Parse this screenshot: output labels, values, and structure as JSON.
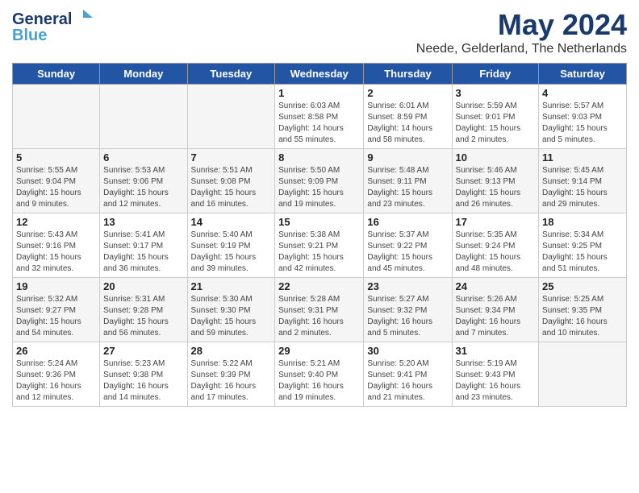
{
  "header": {
    "logo_general": "General",
    "logo_blue": "Blue",
    "month_title": "May 2024",
    "location": "Neede, Gelderland, The Netherlands"
  },
  "days_of_week": [
    "Sunday",
    "Monday",
    "Tuesday",
    "Wednesday",
    "Thursday",
    "Friday",
    "Saturday"
  ],
  "weeks": [
    [
      {
        "day": "",
        "info": ""
      },
      {
        "day": "",
        "info": ""
      },
      {
        "day": "",
        "info": ""
      },
      {
        "day": "1",
        "info": "Sunrise: 6:03 AM\nSunset: 8:58 PM\nDaylight: 14 hours\nand 55 minutes."
      },
      {
        "day": "2",
        "info": "Sunrise: 6:01 AM\nSunset: 8:59 PM\nDaylight: 14 hours\nand 58 minutes."
      },
      {
        "day": "3",
        "info": "Sunrise: 5:59 AM\nSunset: 9:01 PM\nDaylight: 15 hours\nand 2 minutes."
      },
      {
        "day": "4",
        "info": "Sunrise: 5:57 AM\nSunset: 9:03 PM\nDaylight: 15 hours\nand 5 minutes."
      }
    ],
    [
      {
        "day": "5",
        "info": "Sunrise: 5:55 AM\nSunset: 9:04 PM\nDaylight: 15 hours\nand 9 minutes."
      },
      {
        "day": "6",
        "info": "Sunrise: 5:53 AM\nSunset: 9:06 PM\nDaylight: 15 hours\nand 12 minutes."
      },
      {
        "day": "7",
        "info": "Sunrise: 5:51 AM\nSunset: 9:08 PM\nDaylight: 15 hours\nand 16 minutes."
      },
      {
        "day": "8",
        "info": "Sunrise: 5:50 AM\nSunset: 9:09 PM\nDaylight: 15 hours\nand 19 minutes."
      },
      {
        "day": "9",
        "info": "Sunrise: 5:48 AM\nSunset: 9:11 PM\nDaylight: 15 hours\nand 23 minutes."
      },
      {
        "day": "10",
        "info": "Sunrise: 5:46 AM\nSunset: 9:13 PM\nDaylight: 15 hours\nand 26 minutes."
      },
      {
        "day": "11",
        "info": "Sunrise: 5:45 AM\nSunset: 9:14 PM\nDaylight: 15 hours\nand 29 minutes."
      }
    ],
    [
      {
        "day": "12",
        "info": "Sunrise: 5:43 AM\nSunset: 9:16 PM\nDaylight: 15 hours\nand 32 minutes."
      },
      {
        "day": "13",
        "info": "Sunrise: 5:41 AM\nSunset: 9:17 PM\nDaylight: 15 hours\nand 36 minutes."
      },
      {
        "day": "14",
        "info": "Sunrise: 5:40 AM\nSunset: 9:19 PM\nDaylight: 15 hours\nand 39 minutes."
      },
      {
        "day": "15",
        "info": "Sunrise: 5:38 AM\nSunset: 9:21 PM\nDaylight: 15 hours\nand 42 minutes."
      },
      {
        "day": "16",
        "info": "Sunrise: 5:37 AM\nSunset: 9:22 PM\nDaylight: 15 hours\nand 45 minutes."
      },
      {
        "day": "17",
        "info": "Sunrise: 5:35 AM\nSunset: 9:24 PM\nDaylight: 15 hours\nand 48 minutes."
      },
      {
        "day": "18",
        "info": "Sunrise: 5:34 AM\nSunset: 9:25 PM\nDaylight: 15 hours\nand 51 minutes."
      }
    ],
    [
      {
        "day": "19",
        "info": "Sunrise: 5:32 AM\nSunset: 9:27 PM\nDaylight: 15 hours\nand 54 minutes."
      },
      {
        "day": "20",
        "info": "Sunrise: 5:31 AM\nSunset: 9:28 PM\nDaylight: 15 hours\nand 56 minutes."
      },
      {
        "day": "21",
        "info": "Sunrise: 5:30 AM\nSunset: 9:30 PM\nDaylight: 15 hours\nand 59 minutes."
      },
      {
        "day": "22",
        "info": "Sunrise: 5:28 AM\nSunset: 9:31 PM\nDaylight: 16 hours\nand 2 minutes."
      },
      {
        "day": "23",
        "info": "Sunrise: 5:27 AM\nSunset: 9:32 PM\nDaylight: 16 hours\nand 5 minutes."
      },
      {
        "day": "24",
        "info": "Sunrise: 5:26 AM\nSunset: 9:34 PM\nDaylight: 16 hours\nand 7 minutes."
      },
      {
        "day": "25",
        "info": "Sunrise: 5:25 AM\nSunset: 9:35 PM\nDaylight: 16 hours\nand 10 minutes."
      }
    ],
    [
      {
        "day": "26",
        "info": "Sunrise: 5:24 AM\nSunset: 9:36 PM\nDaylight: 16 hours\nand 12 minutes."
      },
      {
        "day": "27",
        "info": "Sunrise: 5:23 AM\nSunset: 9:38 PM\nDaylight: 16 hours\nand 14 minutes."
      },
      {
        "day": "28",
        "info": "Sunrise: 5:22 AM\nSunset: 9:39 PM\nDaylight: 16 hours\nand 17 minutes."
      },
      {
        "day": "29",
        "info": "Sunrise: 5:21 AM\nSunset: 9:40 PM\nDaylight: 16 hours\nand 19 minutes."
      },
      {
        "day": "30",
        "info": "Sunrise: 5:20 AM\nSunset: 9:41 PM\nDaylight: 16 hours\nand 21 minutes."
      },
      {
        "day": "31",
        "info": "Sunrise: 5:19 AM\nSunset: 9:43 PM\nDaylight: 16 hours\nand 23 minutes."
      },
      {
        "day": "",
        "info": ""
      }
    ]
  ]
}
